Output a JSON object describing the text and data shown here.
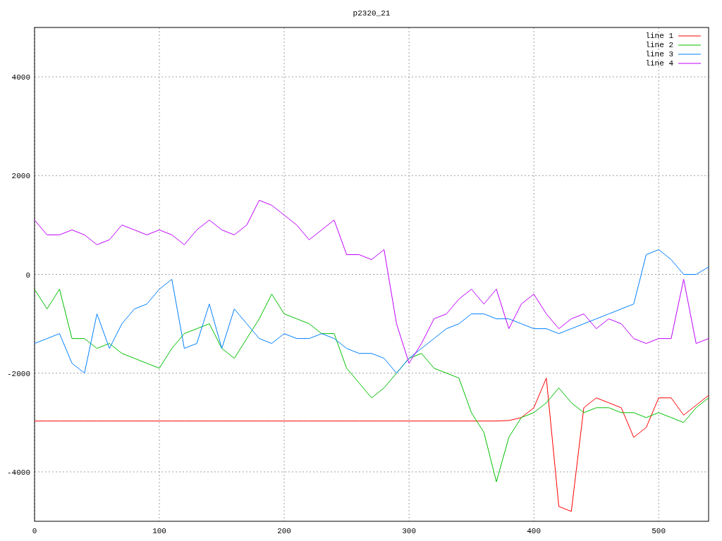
{
  "chart_data": {
    "type": "line",
    "title": "p2320_21",
    "x": [
      0,
      10,
      20,
      30,
      40,
      50,
      60,
      70,
      80,
      90,
      100,
      110,
      120,
      130,
      140,
      150,
      160,
      170,
      180,
      190,
      200,
      210,
      220,
      230,
      240,
      250,
      260,
      270,
      280,
      290,
      300,
      310,
      320,
      330,
      340,
      350,
      360,
      370,
      380,
      390,
      400,
      410,
      420,
      430,
      440,
      450,
      460,
      470,
      480,
      490,
      500,
      510,
      520,
      530,
      540
    ],
    "series": [
      {
        "name": "line 1",
        "color": "#ff0000",
        "values": [
          -2970,
          -2970,
          -2970,
          -2970,
          -2970,
          -2970,
          -2970,
          -2970,
          -2970,
          -2970,
          -2970,
          -2970,
          -2970,
          -2970,
          -2970,
          -2970,
          -2970,
          -2970,
          -2970,
          -2970,
          -2970,
          -2970,
          -2970,
          -2970,
          -2970,
          -2970,
          -2970,
          -2970,
          -2970,
          -2970,
          -2970,
          -2970,
          -2970,
          -2970,
          -2970,
          -2970,
          -2970,
          -2970,
          -2960,
          -2900,
          -2700,
          -2100,
          -4700,
          -4800,
          -2700,
          -2500,
          -2600,
          -2700,
          -3300,
          -3100,
          -2500,
          -2500,
          -2850,
          -2650,
          -2450
        ]
      },
      {
        "name": "line 2",
        "color": "#00c000",
        "values": [
          -300,
          -700,
          -300,
          -1300,
          -1300,
          -1500,
          -1400,
          -1600,
          -1700,
          -1800,
          -1900,
          -1500,
          -1200,
          -1100,
          -1000,
          -1500,
          -1700,
          -1300,
          -900,
          -400,
          -800,
          -900,
          -1000,
          -1200,
          -1200,
          -1900,
          -2200,
          -2500,
          -2300,
          -2000,
          -1700,
          -1600,
          -1900,
          -2000,
          -2100,
          -2800,
          -3200,
          -4200,
          -3300,
          -2900,
          -2800,
          -2600,
          -2300,
          -2600,
          -2800,
          -2700,
          -2700,
          -2800,
          -2800,
          -2900,
          -2800,
          -2900,
          -3000,
          -2700,
          -2500
        ]
      },
      {
        "name": "line 3",
        "color": "#0080ff",
        "values": [
          -1400,
          -1300,
          -1200,
          -1800,
          -2000,
          -800,
          -1500,
          -1000,
          -700,
          -600,
          -300,
          -100,
          -1500,
          -1400,
          -600,
          -1500,
          -700,
          -1000,
          -1300,
          -1400,
          -1200,
          -1300,
          -1300,
          -1200,
          -1300,
          -1500,
          -1600,
          -1600,
          -1700,
          -2000,
          -1700,
          -1500,
          -1300,
          -1100,
          -1000,
          -800,
          -800,
          -900,
          -900,
          -1000,
          -1100,
          -1100,
          -1200,
          -1100,
          -1000,
          -900,
          -800,
          -700,
          -600,
          400,
          500,
          300,
          0,
          0,
          150
        ]
      },
      {
        "name": "line 4",
        "color": "#c000ff",
        "values": [
          1100,
          800,
          800,
          900,
          800,
          600,
          700,
          1000,
          900,
          800,
          900,
          800,
          600,
          900,
          1100,
          900,
          800,
          1000,
          1500,
          1400,
          1200,
          1000,
          700,
          900,
          1100,
          400,
          400,
          300,
          500,
          -1000,
          -1800,
          -1400,
          -900,
          -800,
          -500,
          -300,
          -600,
          -300,
          -1100,
          -600,
          -400,
          -800,
          -1100,
          -900,
          -800,
          -1100,
          -900,
          -1000,
          -1300,
          -1400,
          -1300,
          -1300,
          -100,
          -1400,
          -1300
        ]
      }
    ],
    "xlim": [
      0,
      540
    ],
    "ylim": [
      -5000,
      5000
    ],
    "xticks": [
      0,
      100,
      200,
      300,
      400,
      500
    ],
    "yticks": [
      -4000,
      -2000,
      0,
      2000,
      4000
    ],
    "grid": true,
    "legend": true
  }
}
